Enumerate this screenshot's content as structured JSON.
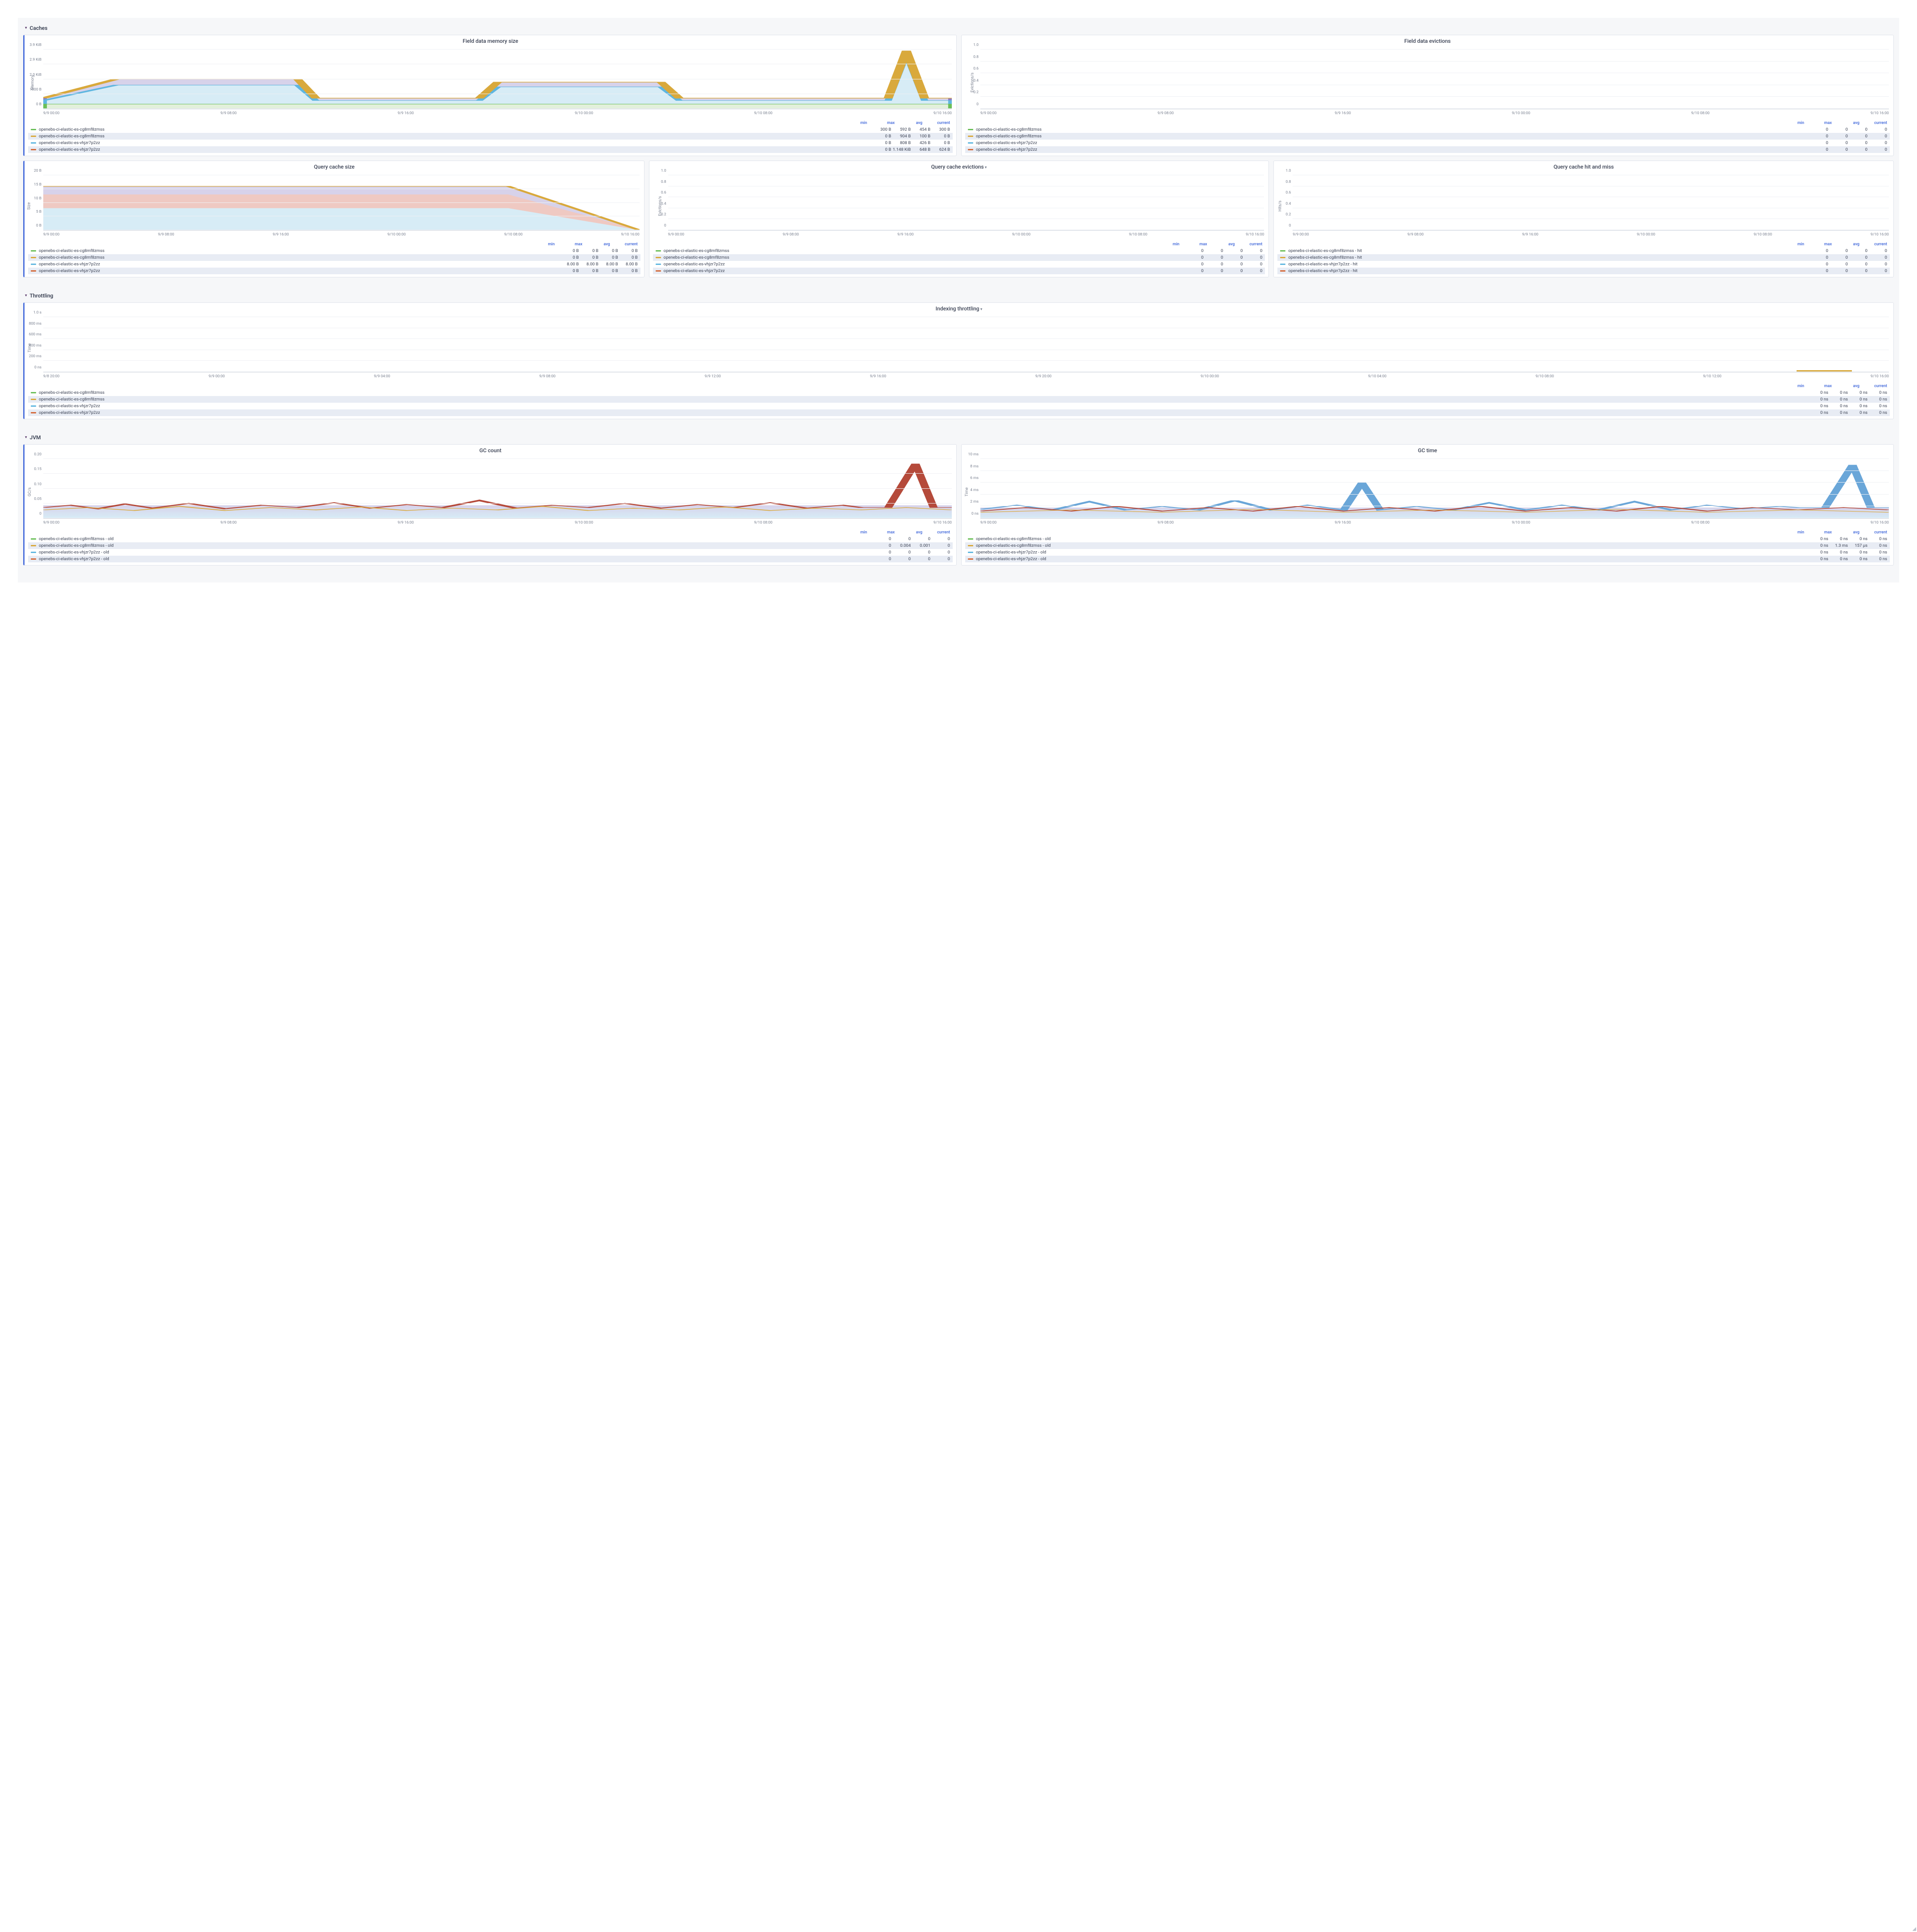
{
  "sections": {
    "caches": "Caches",
    "throttling": "Throttling",
    "jvm": "JVM"
  },
  "legend_cols": {
    "min": "min",
    "max": "max",
    "avg": "avg",
    "current": "current"
  },
  "series_names": {
    "s1": "openebs-ci-elastic-es-cg8mf8zmss",
    "s2": "openebs-ci-elastic-es-cg8mf8zmss",
    "s3": "openebs-ci-elastic-es-vhjzr7p2zz",
    "s4": "openebs-ci-elastic-es-vhjzr7p2zz",
    "s1_hit": "openebs-ci-elastic-es-cg8mf8zmss - hit",
    "s2_hit": "openebs-ci-elastic-es-cg8mf8zmss - hit",
    "s3_hit": "openebs-ci-elastic-es-vhjzr7p2zz - hit",
    "s4_hit": "openebs-ci-elastic-es-vhjzr7p2zz - hit",
    "s1_old": "openebs-ci-elastic-es-cg8mf8zmss - old",
    "s2_old": "openebs-ci-elastic-es-cg8mf8zmss - old",
    "s3_old": "openebs-ci-elastic-es-vhjzr7p2zz - old",
    "s4_old": "openebs-ci-elastic-es-vhjzr7p2zz - old"
  },
  "colors": {
    "s1": "#6bbf59",
    "s2": "#d9a93c",
    "s3": "#5fb6e0",
    "s4": "#d46a3a",
    "purple": "#8a7cc6",
    "red": "#b54a3a",
    "blue2": "#6aa6d8"
  },
  "x_ticks_caches": [
    "9/9 00:00",
    "9/9 08:00",
    "9/9 16:00",
    "9/10 00:00",
    "9/10 08:00",
    "9/10 16:00"
  ],
  "x_ticks_throttling": [
    "9/8 20:00",
    "9/9 00:00",
    "9/9 04:00",
    "9/9 08:00",
    "9/9 12:00",
    "9/9 16:00",
    "9/9 20:00",
    "9/10 00:00",
    "9/10 04:00",
    "9/10 08:00",
    "9/10 12:00",
    "9/10 16:00"
  ],
  "panels": {
    "field_mem": {
      "title": "Field data memory size",
      "ylabel": "Memory",
      "yticks": [
        "0 B",
        "1000 B",
        "2.0 KiB",
        "2.9 KiB",
        "3.9 KiB"
      ],
      "legend": [
        {
          "name": "s1",
          "min": "300 B",
          "max": "592 B",
          "avg": "454 B",
          "cur": "300 B"
        },
        {
          "name": "s2",
          "min": "0 B",
          "max": "904 B",
          "avg": "100 B",
          "cur": "0 B"
        },
        {
          "name": "s3",
          "min": "0 B",
          "max": "808 B",
          "avg": "426 B",
          "cur": "0 B"
        },
        {
          "name": "s4",
          "min": "0 B",
          "max": "1.148 KiB",
          "avg": "648 B",
          "cur": "624 B"
        }
      ]
    },
    "field_evict": {
      "title": "Field data evictions",
      "ylabel": "Evictions/s",
      "yticks": [
        "0",
        "0.2",
        "0.4",
        "0.6",
        "0.8",
        "1.0"
      ],
      "legend": [
        {
          "name": "s1",
          "min": "0",
          "max": "0",
          "avg": "0",
          "cur": "0"
        },
        {
          "name": "s2",
          "min": "0",
          "max": "0",
          "avg": "0",
          "cur": "0"
        },
        {
          "name": "s3",
          "min": "0",
          "max": "0",
          "avg": "0",
          "cur": "0"
        },
        {
          "name": "s4",
          "min": "0",
          "max": "0",
          "avg": "0",
          "cur": "0"
        }
      ]
    },
    "qcache_size": {
      "title": "Query cache size",
      "ylabel": "Size",
      "yticks": [
        "0 B",
        "5 B",
        "10 B",
        "15 B",
        "20 B"
      ],
      "legend": [
        {
          "name": "s1",
          "min": "0 B",
          "max": "0 B",
          "avg": "0 B",
          "cur": "0 B"
        },
        {
          "name": "s2",
          "min": "0 B",
          "max": "0 B",
          "avg": "0 B",
          "cur": "0 B"
        },
        {
          "name": "s3",
          "min": "8.00 B",
          "max": "8.00 B",
          "avg": "8.00 B",
          "cur": "8.00 B"
        },
        {
          "name": "s4",
          "min": "0 B",
          "max": "0 B",
          "avg": "0 B",
          "cur": "0 B"
        }
      ]
    },
    "qcache_evict": {
      "title": "Query cache evictions",
      "ylabel": "Evictions/s",
      "yticks": [
        "0",
        "0.2",
        "0.4",
        "0.6",
        "0.8",
        "1.0"
      ],
      "legend": [
        {
          "name": "s1",
          "min": "0",
          "max": "0",
          "avg": "0",
          "cur": "0"
        },
        {
          "name": "s2",
          "min": "0",
          "max": "0",
          "avg": "0",
          "cur": "0"
        },
        {
          "name": "s3",
          "min": "0",
          "max": "0",
          "avg": "0",
          "cur": "0"
        },
        {
          "name": "s4",
          "min": "0",
          "max": "0",
          "avg": "0",
          "cur": "0"
        }
      ]
    },
    "qcache_hit": {
      "title": "Query cache hit and miss",
      "ylabel": "Hits/s",
      "yticks": [
        "0",
        "0.2",
        "0.4",
        "0.6",
        "0.8",
        "1.0"
      ],
      "legend": [
        {
          "name": "s1_hit",
          "min": "0",
          "max": "0",
          "avg": "0",
          "cur": "0"
        },
        {
          "name": "s2_hit",
          "min": "0",
          "max": "0",
          "avg": "0",
          "cur": "0"
        },
        {
          "name": "s3_hit",
          "min": "0",
          "max": "0",
          "avg": "0",
          "cur": "0"
        },
        {
          "name": "s4_hit",
          "min": "0",
          "max": "0",
          "avg": "0",
          "cur": "0"
        }
      ]
    },
    "idx_throttle": {
      "title": "Indexing throttling",
      "ylabel": "Time",
      "yticks": [
        "0 ns",
        "200 ms",
        "400 ms",
        "600 ms",
        "800 ms",
        "1.0 s"
      ],
      "legend": [
        {
          "name": "s1",
          "min": "0 ns",
          "max": "0 ns",
          "avg": "0 ns",
          "cur": "0 ns"
        },
        {
          "name": "s2",
          "min": "0 ns",
          "max": "0 ns",
          "avg": "0 ns",
          "cur": "0 ns"
        },
        {
          "name": "s3",
          "min": "0 ns",
          "max": "0 ns",
          "avg": "0 ns",
          "cur": "0 ns"
        },
        {
          "name": "s4",
          "min": "0 ns",
          "max": "0 ns",
          "avg": "0 ns",
          "cur": "0 ns"
        }
      ]
    },
    "gc_count": {
      "title": "GC count",
      "ylabel": "GC/s",
      "yticks": [
        "0",
        "0.05",
        "0.10",
        "0.15",
        "0.20"
      ],
      "legend": [
        {
          "name": "s1_old",
          "min": "0",
          "max": "0",
          "avg": "0",
          "cur": "0"
        },
        {
          "name": "s2_old",
          "min": "0",
          "max": "0.004",
          "avg": "0.001",
          "cur": "0"
        },
        {
          "name": "s3_old",
          "min": "0",
          "max": "0",
          "avg": "0",
          "cur": "0"
        },
        {
          "name": "s4_old",
          "min": "0",
          "max": "0",
          "avg": "0",
          "cur": "0"
        }
      ]
    },
    "gc_time": {
      "title": "GC time",
      "ylabel": "Time",
      "yticks": [
        "0 ns",
        "2 ms",
        "4 ms",
        "6 ms",
        "8 ms",
        "10 ms"
      ],
      "legend": [
        {
          "name": "s1_old",
          "min": "0 ns",
          "max": "0 ns",
          "avg": "0 ns",
          "cur": "0 ns"
        },
        {
          "name": "s2_old",
          "min": "0 ns",
          "max": "1.3 ms",
          "avg": "157 µs",
          "cur": "0 ns"
        },
        {
          "name": "s3_old",
          "min": "0 ns",
          "max": "0 ns",
          "avg": "0 ns",
          "cur": "0 ns"
        },
        {
          "name": "s4_old",
          "min": "0 ns",
          "max": "0 ns",
          "avg": "0 ns",
          "cur": "0 ns"
        }
      ]
    }
  },
  "chart_data": [
    {
      "panel": "field_mem",
      "type": "area",
      "title": "Field data memory size",
      "ylabel": "Memory",
      "ylim": [
        0,
        4000
      ],
      "x": [
        "9/9 00:00",
        "9/9 08:00",
        "9/9 16:00",
        "9/10 00:00",
        "9/10 08:00",
        "9/10 16:00"
      ],
      "series": [
        {
          "name": "openebs-ci-elastic-es-cg8mf8zmss",
          "values_bytes": [
            300,
            592,
            300,
            592,
            300,
            300
          ]
        },
        {
          "name": "openebs-ci-elastic-es-cg8mf8zmss",
          "values_bytes": [
            0,
            904,
            0,
            904,
            0,
            0
          ]
        },
        {
          "name": "openebs-ci-elastic-es-vhjzr7p2zz",
          "values_bytes": [
            0,
            808,
            0,
            808,
            0,
            0
          ]
        },
        {
          "name": "openebs-ci-elastic-es-vhjzr7p2zz",
          "values_bytes": [
            624,
            1148,
            624,
            1148,
            624,
            3900
          ]
        }
      ]
    },
    {
      "panel": "field_evict",
      "type": "line",
      "title": "Field data evictions",
      "ylabel": "Evictions/s",
      "ylim": [
        0,
        1
      ],
      "x": [
        "9/9 00:00",
        "9/9 08:00",
        "9/9 16:00",
        "9/10 00:00",
        "9/10 08:00",
        "9/10 16:00"
      ],
      "series": [
        {
          "name": "openebs-ci-elastic-es-cg8mf8zmss",
          "values": [
            0,
            0,
            0,
            0,
            0,
            0
          ]
        },
        {
          "name": "openebs-ci-elastic-es-cg8mf8zmss",
          "values": [
            0,
            0,
            0,
            0,
            0,
            0
          ]
        },
        {
          "name": "openebs-ci-elastic-es-vhjzr7p2zz",
          "values": [
            0,
            0,
            0,
            0,
            0,
            0
          ]
        },
        {
          "name": "openebs-ci-elastic-es-vhjzr7p2zz",
          "values": [
            0,
            0,
            0,
            0,
            0,
            0
          ]
        }
      ]
    },
    {
      "panel": "qcache_size",
      "type": "area",
      "title": "Query cache size",
      "ylabel": "Size",
      "ylim": [
        0,
        20
      ],
      "x": [
        "9/9 00:00",
        "9/9 08:00",
        "9/9 16:00",
        "9/10 00:00",
        "9/10 08:00",
        "9/10 16:00"
      ],
      "series": [
        {
          "name": "openebs-ci-elastic-es-cg8mf8zmss",
          "values_bytes": [
            0,
            0,
            0,
            0,
            0,
            0
          ]
        },
        {
          "name": "openebs-ci-elastic-es-cg8mf8zmss",
          "values_bytes": [
            0,
            0,
            0,
            0,
            0,
            0
          ]
        },
        {
          "name": "openebs-ci-elastic-es-vhjzr7p2zz",
          "values_bytes": [
            8,
            8,
            8,
            8,
            8,
            8
          ],
          "stacked_top": 16
        },
        {
          "name": "openebs-ci-elastic-es-vhjzr7p2zz",
          "values_bytes": [
            0,
            0,
            0,
            0,
            0,
            0
          ]
        }
      ]
    },
    {
      "panel": "qcache_evict",
      "type": "line",
      "title": "Query cache evictions",
      "ylabel": "Evictions/s",
      "ylim": [
        0,
        1
      ],
      "x": [
        "9/9 00:00",
        "9/9 08:00",
        "9/9 16:00",
        "9/10 00:00",
        "9/10 08:00",
        "9/10 16:00"
      ],
      "series": [
        {
          "name": "openebs-ci-elastic-es-cg8mf8zmss",
          "values": [
            0,
            0,
            0,
            0,
            0,
            0
          ]
        },
        {
          "name": "openebs-ci-elastic-es-cg8mf8zmss",
          "values": [
            0,
            0,
            0,
            0,
            0,
            0
          ]
        },
        {
          "name": "openebs-ci-elastic-es-vhjzr7p2zz",
          "values": [
            0,
            0,
            0,
            0,
            0,
            0
          ]
        },
        {
          "name": "openebs-ci-elastic-es-vhjzr7p2zz",
          "values": [
            0,
            0,
            0,
            0,
            0,
            0
          ]
        }
      ]
    },
    {
      "panel": "qcache_hit",
      "type": "line",
      "title": "Query cache hit and miss",
      "ylabel": "Hits/s",
      "ylim": [
        0,
        1
      ],
      "x": [
        "9/9 00:00",
        "9/9 08:00",
        "9/9 16:00",
        "9/10 00:00",
        "9/10 08:00",
        "9/10 16:00"
      ],
      "series": [
        {
          "name": "openebs-ci-elastic-es-cg8mf8zmss - hit",
          "values": [
            0,
            0,
            0,
            0,
            0,
            0
          ]
        },
        {
          "name": "openebs-ci-elastic-es-cg8mf8zmss - hit",
          "values": [
            0,
            0,
            0,
            0,
            0,
            0
          ]
        },
        {
          "name": "openebs-ci-elastic-es-vhjzr7p2zz - hit",
          "values": [
            0,
            0,
            0,
            0,
            0,
            0
          ]
        },
        {
          "name": "openebs-ci-elastic-es-vhjzr7p2zz - hit",
          "values": [
            0,
            0,
            0,
            0,
            0,
            0
          ]
        }
      ]
    },
    {
      "panel": "idx_throttle",
      "type": "line",
      "title": "Indexing throttling",
      "ylabel": "Time",
      "ylim_ms": [
        0,
        1000
      ],
      "x": [
        "9/8 20:00",
        "9/9 00:00",
        "9/9 04:00",
        "9/9 08:00",
        "9/9 12:00",
        "9/9 16:00",
        "9/9 20:00",
        "9/10 00:00",
        "9/10 04:00",
        "9/10 08:00",
        "9/10 12:00",
        "9/10 16:00"
      ],
      "series": [
        {
          "name": "openebs-ci-elastic-es-cg8mf8zmss",
          "values_ns": [
            0,
            0,
            0,
            0,
            0,
            0,
            0,
            0,
            0,
            0,
            0,
            0
          ]
        },
        {
          "name": "openebs-ci-elastic-es-cg8mf8zmss",
          "values_ns": [
            0,
            0,
            0,
            0,
            0,
            0,
            0,
            0,
            0,
            0,
            0,
            0
          ]
        },
        {
          "name": "openebs-ci-elastic-es-vhjzr7p2zz",
          "values_ns": [
            0,
            0,
            0,
            0,
            0,
            0,
            0,
            0,
            0,
            0,
            0,
            0
          ]
        },
        {
          "name": "openebs-ci-elastic-es-vhjzr7p2zz",
          "values_ns": [
            0,
            0,
            0,
            0,
            0,
            0,
            0,
            0,
            0,
            0,
            0,
            0
          ]
        }
      ]
    },
    {
      "panel": "gc_count",
      "type": "line",
      "title": "GC count",
      "ylabel": "GC/s",
      "ylim": [
        0,
        0.2
      ],
      "x": [
        "9/9 00:00",
        "9/9 08:00",
        "9/9 16:00",
        "9/10 00:00",
        "9/10 08:00",
        "9/10 16:00"
      ],
      "series": [
        {
          "name": "openebs-ci-elastic-es-cg8mf8zmss - old",
          "approx_mean": 0.03,
          "approx_peak": 0.06
        },
        {
          "name": "openebs-ci-elastic-es-cg8mf8zmss - old",
          "approx_mean": 0.03,
          "approx_peak": 0.05
        },
        {
          "name": "openebs-ci-elastic-es-vhjzr7p2zz - old",
          "approx_mean": 0.03,
          "approx_peak": 0.05
        },
        {
          "name": "openebs-ci-elastic-es-vhjzr7p2zz - old",
          "approx_mean": 0.03,
          "approx_peak": 0.19,
          "peak_x": "9/10 16:00"
        }
      ]
    },
    {
      "panel": "gc_time",
      "type": "line",
      "title": "GC time",
      "ylabel": "Time",
      "ylim_ms": [
        0,
        10
      ],
      "x": [
        "9/9 00:00",
        "9/9 08:00",
        "9/9 16:00",
        "9/10 00:00",
        "9/10 08:00",
        "9/10 16:00"
      ],
      "series": [
        {
          "name": "openebs-ci-elastic-es-cg8mf8zmss - old",
          "approx_mean_ms": 1.0,
          "approx_peak_ms": 3.0
        },
        {
          "name": "openebs-ci-elastic-es-cg8mf8zmss - old",
          "approx_mean_ms": 1.2,
          "approx_peak_ms": 6.0
        },
        {
          "name": "openebs-ci-elastic-es-vhjzr7p2zz - old",
          "approx_mean_ms": 1.0,
          "approx_peak_ms": 9.0,
          "peak_x": "9/10 16:00"
        },
        {
          "name": "openebs-ci-elastic-es-vhjzr7p2zz - old",
          "approx_mean_ms": 1.0,
          "approx_peak_ms": 2.5
        }
      ]
    }
  ]
}
